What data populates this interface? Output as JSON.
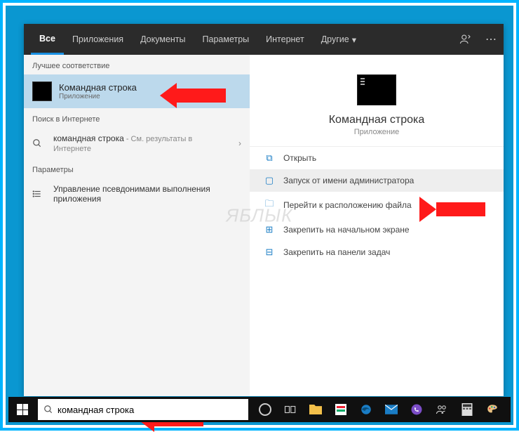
{
  "tabs": {
    "all": "Все",
    "apps": "Приложения",
    "docs": "Документы",
    "params": "Параметры",
    "internet": "Интернет",
    "other": "Другие"
  },
  "left": {
    "best_label": "Лучшее соответствие",
    "best_title": "Командная строка",
    "best_sub": "Приложение",
    "web_label": "Поиск в Интернете",
    "web_query": "командная строка",
    "web_sub": " - См. результаты в Интернете",
    "params_label": "Параметры",
    "param_text": "Управление псевдонимами выполнения приложения"
  },
  "detail": {
    "title": "Командная строка",
    "sub": "Приложение",
    "actions": {
      "open": "Открыть",
      "run_admin": "Запуск от имени администратора",
      "goto": "Перейти к расположению файла",
      "pin_start": "Закрепить на начальном экране",
      "pin_task": "Закрепить на панели задач"
    }
  },
  "search": {
    "value": "командная строка"
  },
  "watermark": "ЯБЛЫК"
}
